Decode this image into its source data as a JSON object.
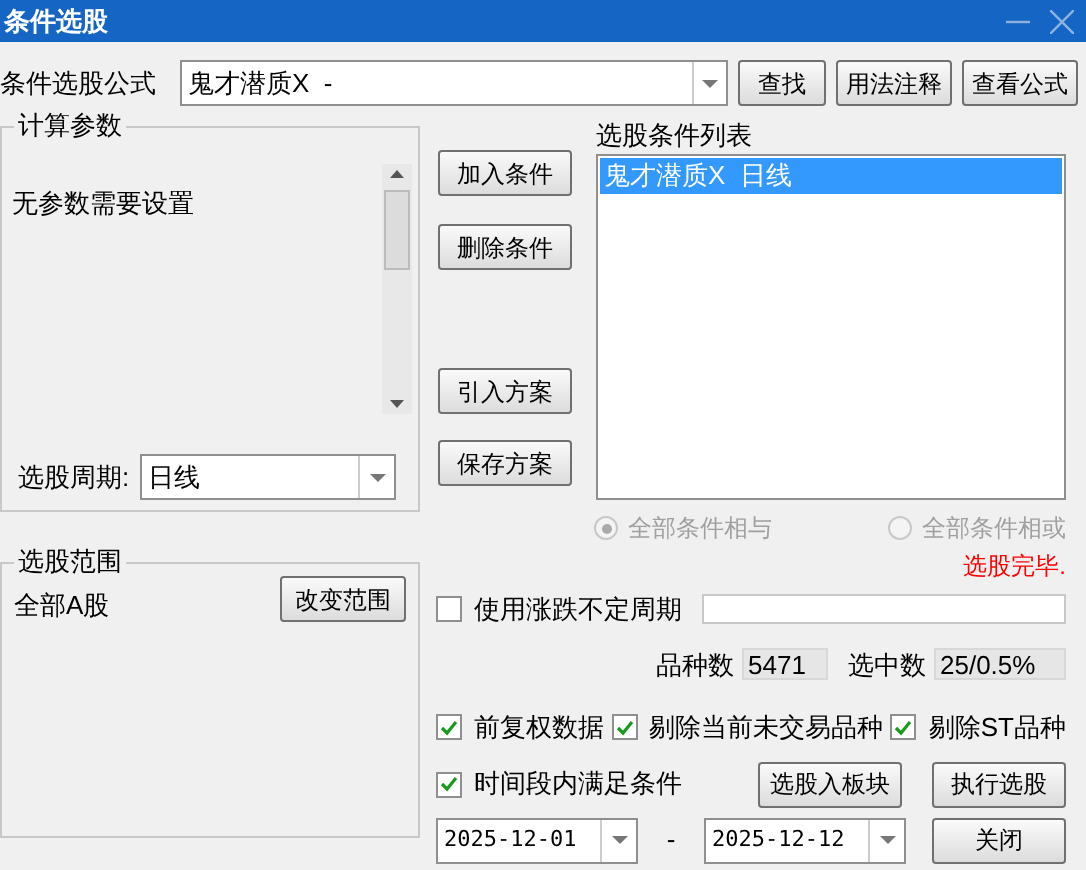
{
  "window": {
    "title": "条件选股"
  },
  "formula": {
    "label": "条件选股公式",
    "value": "鬼才潜质X  -"
  },
  "top_buttons": [
    "查找",
    "用法注释",
    "查看公式"
  ],
  "params": {
    "title": "计算参数",
    "text": "无参数需要设置"
  },
  "period": {
    "label": "选股周期:",
    "value": "日线"
  },
  "range": {
    "title": "选股范围",
    "value": "全部A股",
    "button": "改变范围"
  },
  "action_buttons": [
    "加入条件",
    "删除条件",
    "引入方案",
    "保存方案"
  ],
  "conditions": {
    "title": "选股条件列表",
    "items": [
      {
        "label": "鬼才潜质X  日线",
        "selected": true
      }
    ]
  },
  "logic_options": [
    {
      "label": "全部条件相与",
      "selected": true,
      "disabled": true
    },
    {
      "label": "全部条件相或",
      "selected": false,
      "disabled": true
    }
  ],
  "status": "选股完毕.",
  "variable_period": {
    "label": "使用涨跌不定周期",
    "checked": false
  },
  "counts": [
    {
      "label": "品种数",
      "value": "5471"
    },
    {
      "label": "选中数",
      "value": "25/0.5%"
    }
  ],
  "options": [
    {
      "label": "前复权数据",
      "checked": true
    },
    {
      "label": "剔除当前未交易品种",
      "checked": true
    },
    {
      "label": "剔除ST品种",
      "checked": true
    }
  ],
  "time_range": {
    "label": "时间段内满足条件",
    "checked": true
  },
  "block_button": "选股入板块",
  "run_button": "执行选股",
  "dates": {
    "start": "2025-12-01",
    "separator": "-",
    "end": "2025-12-12"
  },
  "close_button": "关闭"
}
